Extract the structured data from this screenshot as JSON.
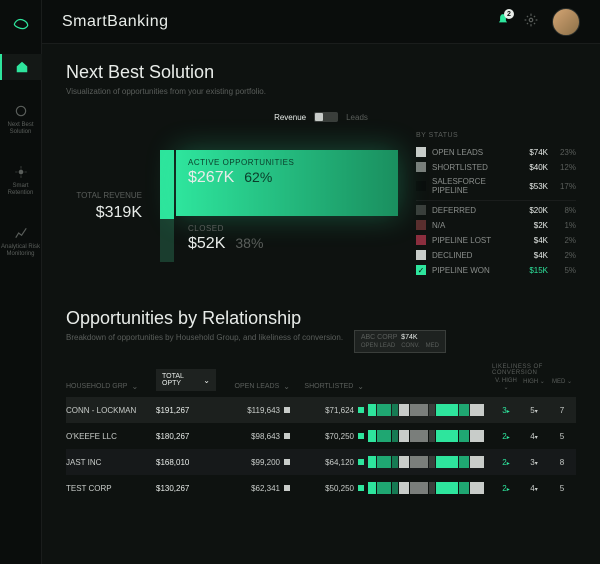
{
  "brand": "SmartBanking",
  "notifications": {
    "count": "2"
  },
  "nav": {
    "items": [
      {
        "label": ""
      },
      {
        "label": "Next Best Solution"
      },
      {
        "label": "Smart Retention"
      },
      {
        "label": "Analytical Risk Monitoring"
      }
    ]
  },
  "nbs": {
    "title": "Next Best Solution",
    "subtitle": "Visualization of opportunities from your existing portfolio.",
    "toggle": {
      "left": "Revenue",
      "right": "Leads"
    },
    "totalRevenue": {
      "label": "TOTAL REVENUE",
      "value": "$319K"
    },
    "active": {
      "label": "ACTIVE OPPORTUNITIES",
      "amount": "$267K",
      "pct": "62%"
    },
    "closed": {
      "label": "CLOSED",
      "amount": "$52K",
      "pct": "38%"
    },
    "statusHeader": "BY STATUS",
    "statuses": [
      {
        "name": "OPEN LEADS",
        "amount": "$74K",
        "pct": "23%",
        "color": "#c8ccc9"
      },
      {
        "name": "SHORTLISTED",
        "amount": "$40K",
        "pct": "12%",
        "color": "#7a7e7b"
      },
      {
        "name": "SALESFORCE PIPELINE",
        "amount": "$53K",
        "pct": "17%",
        "color": "#0a0d0c"
      },
      {
        "name": "DEFERRED",
        "amount": "$20K",
        "pct": "8%",
        "color": "#3a3e3b"
      },
      {
        "name": "N/A",
        "amount": "$2K",
        "pct": "1%",
        "color": "#5a2e2e"
      },
      {
        "name": "PIPELINE LOST",
        "amount": "$4K",
        "pct": "2%",
        "color": "#8b2e3e"
      },
      {
        "name": "DECLINED",
        "amount": "$4K",
        "pct": "2%",
        "color": "#c8ccc9"
      },
      {
        "name": "PIPELINE WON",
        "amount": "$15K",
        "pct": "5%",
        "color": "#2ee59d"
      }
    ]
  },
  "rel": {
    "title": "Opportunities by Relationship",
    "subtitle": "Breakdown of opportunities by Household Group, and likeliness of conversion.",
    "headers": {
      "grp": "HOUSEHOLD GRP",
      "opty": "TOTAL OPTY",
      "open": "OPEN LEADS",
      "short": "SHORTLISTED",
      "like": "LIKELINESS OF CONVERSION",
      "cols": {
        "vhigh": "V. HIGH",
        "high": "HIGH",
        "med": "MED"
      }
    },
    "tooltip": {
      "name": "ABC CORP",
      "amt": "$74K",
      "tag1": "OPEN LEAD",
      "tag2": "MED",
      "conv": "CONV."
    },
    "rows": [
      {
        "grp": "CONN - LOCKMAN",
        "opty": "$191,267",
        "open": "$119,643",
        "short": "$71,624",
        "vhigh": "3",
        "high": "5",
        "med": "7"
      },
      {
        "grp": "O'KEEFE LLC",
        "opty": "$180,267",
        "open": "$98,643",
        "short": "$70,250",
        "vhigh": "2",
        "high": "4",
        "med": "5"
      },
      {
        "grp": "JAST INC",
        "opty": "$168,010",
        "open": "$99,200",
        "short": "$64,120",
        "vhigh": "2",
        "high": "3",
        "med": "8"
      },
      {
        "grp": "TEST CORP",
        "opty": "$130,267",
        "open": "$62,341",
        "short": "$50,250",
        "vhigh": "2",
        "high": "4",
        "med": "5"
      }
    ]
  },
  "chart_data": {
    "type": "bar",
    "title": "Next Best Solution — Revenue by Status",
    "total": 319,
    "unit": "$K",
    "segments": [
      {
        "name": "Active Opportunities",
        "value": 267,
        "pct": 62
      },
      {
        "name": "Closed",
        "value": 52,
        "pct": 38
      }
    ],
    "by_status": [
      {
        "name": "Open Leads",
        "value": 74,
        "pct": 23
      },
      {
        "name": "Shortlisted",
        "value": 40,
        "pct": 12
      },
      {
        "name": "Salesforce Pipeline",
        "value": 53,
        "pct": 17
      },
      {
        "name": "Deferred",
        "value": 20,
        "pct": 8
      },
      {
        "name": "N/A",
        "value": 2,
        "pct": 1
      },
      {
        "name": "Pipeline Lost",
        "value": 4,
        "pct": 2
      },
      {
        "name": "Declined",
        "value": 4,
        "pct": 2
      },
      {
        "name": "Pipeline Won",
        "value": 15,
        "pct": 5
      }
    ]
  }
}
